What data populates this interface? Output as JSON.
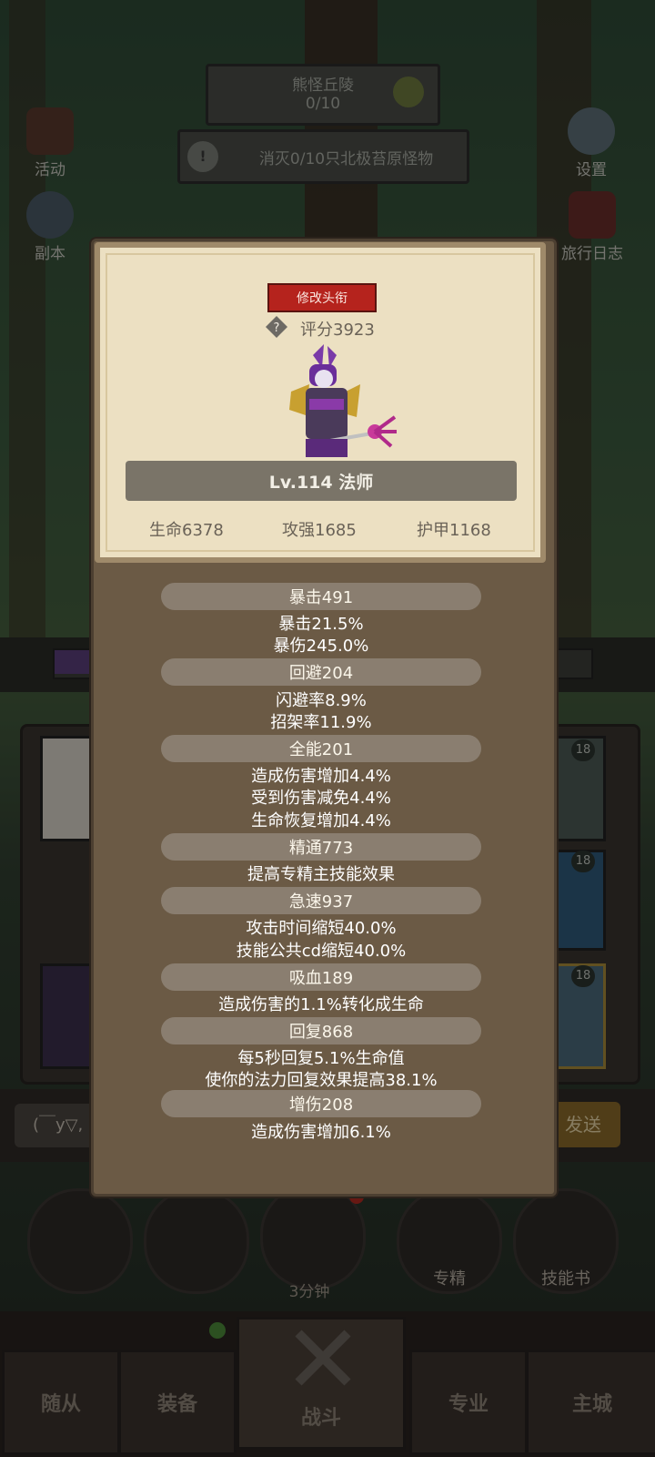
{
  "top": {
    "zone_name": "熊怪丘陵",
    "zone_progress": "0/10",
    "quest_text": "消灭0/10只北极苔原怪物",
    "quest_icon": "exclamation-icon",
    "refresh_icon": "refresh-arrows-icon"
  },
  "side": {
    "activity": "活动",
    "dungeon": "副本",
    "settings": "设置",
    "travel_log": "旅行日志"
  },
  "chat": {
    "input_preview": "(￣y▽,",
    "send_label": "发送"
  },
  "actions": {
    "timer": "3分钟",
    "specialize": "专精",
    "skill_book": "技能书"
  },
  "nav": {
    "followers": "随从",
    "equipment": "装备",
    "battle": "战斗",
    "profession": "专业",
    "main_city": "主城"
  },
  "badges": {
    "slot_level": "18"
  },
  "hero": {
    "change_title_button": "修改头衔",
    "score": "评分3923",
    "level_class": "Lv.114 法师",
    "hp": "生命6378",
    "attack": "攻强1685",
    "armor": "护甲1168"
  },
  "stats": {
    "crit": "暴击491",
    "crit_rate": "暴击21.5%",
    "crit_damage": "暴伤245.0%",
    "avoid": "回避204",
    "dodge": "闪避率8.9%",
    "parry": "招架率11.9%",
    "versatility": "全能201",
    "vers_damage": "造成伤害增加4.4%",
    "vers_reduction": "受到伤害减免4.4%",
    "vers_heal": "生命恢复增加4.4%",
    "mastery": "精通773",
    "mastery_desc": "提高专精主技能效果",
    "haste": "急速937",
    "haste_attack": "攻击时间缩短40.0%",
    "haste_cd": "技能公共cd缩短40.0%",
    "leech": "吸血189",
    "leech_desc": "造成伤害的1.1%转化成生命",
    "regen": "回复868",
    "regen_hp": "每5秒回复5.1%生命值",
    "regen_mana": "使你的法力回复效果提高38.1%",
    "dmg_bonus": "增伤208",
    "dmg_bonus_desc": "造成伤害增加6.1%"
  }
}
